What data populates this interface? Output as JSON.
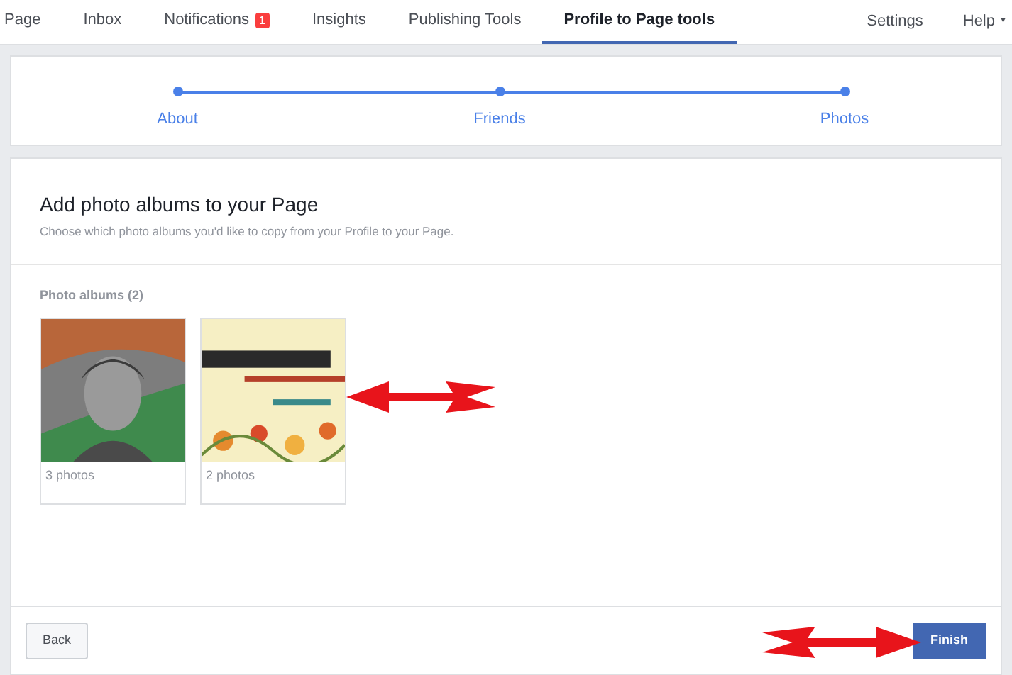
{
  "nav": {
    "tabs": [
      {
        "label": "Page",
        "selected": false
      },
      {
        "label": "Inbox",
        "selected": false
      },
      {
        "label": "Notifications",
        "selected": false,
        "badge": "1"
      },
      {
        "label": "Insights",
        "selected": false
      },
      {
        "label": "Publishing Tools",
        "selected": false
      },
      {
        "label": "Profile to Page tools",
        "selected": true
      }
    ],
    "right": [
      {
        "label": "Settings",
        "kind": "link"
      },
      {
        "label": "Help",
        "kind": "menu",
        "caret": "▾"
      }
    ]
  },
  "steps": [
    {
      "label": "About"
    },
    {
      "label": "Friends"
    },
    {
      "label": "Photos"
    }
  ],
  "section": {
    "title": "Add photo albums to your Page",
    "subtitle": "Choose which photo albums you'd like to copy from your Profile to your Page."
  },
  "albums": {
    "heading": "Photo albums (2)",
    "items": [
      {
        "kind": "portrait",
        "count": "3 photos"
      },
      {
        "kind": "poster",
        "count": "2 photos"
      }
    ]
  },
  "footer": {
    "back": "Back",
    "finish": "Finish"
  },
  "annotations": [
    {
      "points_right": false
    },
    {
      "points_right": true
    }
  ]
}
